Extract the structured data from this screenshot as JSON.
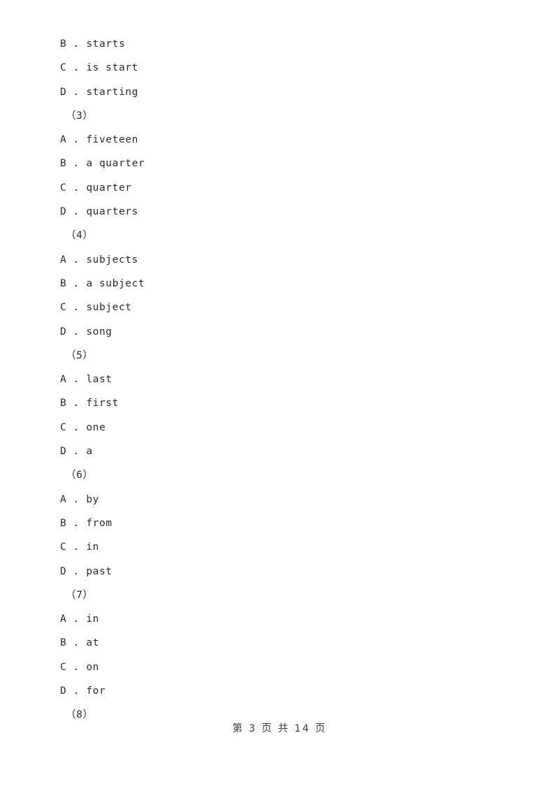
{
  "document": {
    "background_color": "#ffffff",
    "text_color": "#2b2b2b",
    "lines": [
      {
        "kind": "option",
        "text": "B . starts"
      },
      {
        "kind": "option",
        "text": "C . is start"
      },
      {
        "kind": "option",
        "text": "D . starting"
      },
      {
        "kind": "qnum",
        "text": "（3）"
      },
      {
        "kind": "option",
        "text": "A . fiveteen"
      },
      {
        "kind": "option",
        "text": "B . a quarter"
      },
      {
        "kind": "option",
        "text": "C . quarter"
      },
      {
        "kind": "option",
        "text": "D . quarters"
      },
      {
        "kind": "qnum",
        "text": "（4）"
      },
      {
        "kind": "option",
        "text": "A . subjects"
      },
      {
        "kind": "option",
        "text": "B . a subject"
      },
      {
        "kind": "option",
        "text": "C . subject"
      },
      {
        "kind": "option",
        "text": "D . song"
      },
      {
        "kind": "qnum",
        "text": "（5）"
      },
      {
        "kind": "option",
        "text": "A . last"
      },
      {
        "kind": "option",
        "text": "B . first"
      },
      {
        "kind": "option",
        "text": "C . one"
      },
      {
        "kind": "option",
        "text": "D . a"
      },
      {
        "kind": "qnum",
        "text": "（6）"
      },
      {
        "kind": "option",
        "text": "A . by"
      },
      {
        "kind": "option",
        "text": "B . from"
      },
      {
        "kind": "option",
        "text": "C . in"
      },
      {
        "kind": "option",
        "text": "D . past"
      },
      {
        "kind": "qnum",
        "text": "（7）"
      },
      {
        "kind": "option",
        "text": "A . in"
      },
      {
        "kind": "option",
        "text": "B . at"
      },
      {
        "kind": "option",
        "text": "C . on"
      },
      {
        "kind": "option",
        "text": "D . for"
      },
      {
        "kind": "qnum",
        "text": "（8）"
      }
    ]
  },
  "footer": {
    "text": "第 3 页 共 14 页",
    "current_page": "3",
    "total_pages": "14"
  }
}
